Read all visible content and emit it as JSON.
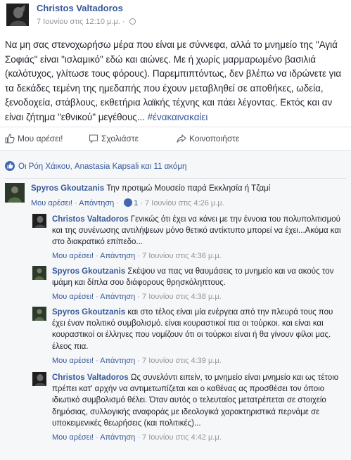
{
  "post": {
    "author": "Christos Valtadoros",
    "timestamp": "7 Ιουνίου στις 12:10 μ.μ.",
    "audience_icon": "globe-icon",
    "text": "Να μη σας στενοχωρήσω μέρα που είναι με σύννεφα, αλλά το μνημείο της \"Αγιά Σοφιάς\" είναι \"ισλαμικό\" εδώ και αιώνες. Με ή χωρίς μαρμαρωμένο βασιλιά (καλότυχος, γλίτωσε τους φόρους). Παρεμπιπτόντως, δεν βλέπω να ιδρώνετε για τα δεκάδες τεμένη της ημεδαπής που έχουν μεταβληθεί σε αποθήκες, ωδεία, ξενοδοχεία, στάβλους, εκθετήρια λαϊκής τέχνης και πάει λέγοντας. Εκτός και αν είναι ζήτημα \"εθνικού\" μεγέθους... ",
    "hashtag": "#ένακαινακαίει"
  },
  "actions": {
    "like": "Μου αρέσει!",
    "comment": "Σχολιάστε",
    "share": "Κοινοποιήστε"
  },
  "likers": "Οι Ρόη Χάικου, Anastasia Kapsali και 11 ακόμη",
  "comments": [
    {
      "author": "Spyros Gkoutzanis",
      "text": "Την προτιμώ Μουσείο παρά Εκκλησία ή Τζαμί",
      "like": "Μου αρέσει!",
      "reply": "Απάντηση",
      "likes": "1",
      "time": "7 Ιουνίου στις 4:26 μ.μ."
    },
    {
      "author": "Christos Valtadoros",
      "text": "Γενικώς ότι έχει να κάνει με την έννοια του πολυπολιτισμού και της συνένωσης αντιλήψεων μόνο θετικό αντίκτυπο μπορεί να έχει...Ακόμα και στο διακρατικό επίπεδο...",
      "like": "Μου αρέσει!",
      "reply": "Απάντηση",
      "time": "7 Ιουνίου στις 4:36 μ.μ."
    },
    {
      "author": "Spyros Gkoutzanis",
      "text": "Σκέψου να πας να θαυμάσεις το μνημείο και να ακούς τον ιμάμη και δίπλα σου διάφορους θρησκόληπτους.",
      "like": "Μου αρέσει!",
      "reply": "Απάντηση",
      "time": "7 Ιουνίου στις 4:38 μ.μ."
    },
    {
      "author": "Spyros Gkoutzanis",
      "text": "και στο τέλος είναι μία ενέργεια από την πλευρά τους που έχει έναν πολιτικό συμβολισμό. είναι κουραστικοί πια οι τούρκοι. και είναι και κουραστικοί οι έλληνες που νομίζουν ότι οι τούρκοι είναι ή θα γίνουν φίλοι μας. έλεος πια.",
      "like": "Μου αρέσει!",
      "reply": "Απάντηση",
      "time": "7 Ιουνίου στις 4:39 μ.μ."
    },
    {
      "author": "Christos Valtadoros",
      "text": "Ως συνελόντι ειπείν, το μνημείο είναι μνημείο και ως τέτοιο πρέπει κατ' αρχήν να αντιμετωπίζεται και ο καθένας ας προσθέσει τον όποιο ιδιωτικό συμβολισμό θέλει. Όταν αυτός ο τελευταίος μετατρέπεται σε στοιχείο δημόσιας, συλλογικής αναφοράς με ιδεολογικά χαρακτηριστικά περνάμε σε υποκειμενικές θεωρήσεις (και πολιτικές)...",
      "like": "Μου αρέσει!",
      "reply": "Απάντηση",
      "time": "7 Ιουνίου στις 4:42 μ.μ."
    }
  ]
}
